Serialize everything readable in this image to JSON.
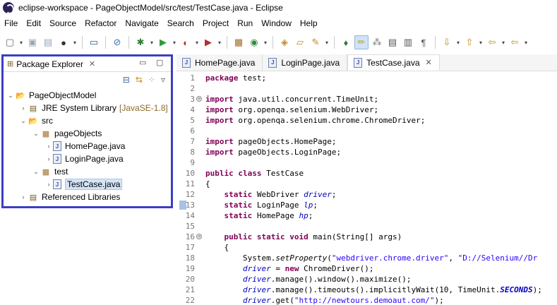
{
  "window": {
    "title": "eclipse-workspace - PageObjectModel/src/test/TestCase.java - Eclipse"
  },
  "menu": [
    "File",
    "Edit",
    "Source",
    "Refactor",
    "Navigate",
    "Search",
    "Project",
    "Run",
    "Window",
    "Help"
  ],
  "toolbar": {
    "icons": [
      "new-icon",
      "save-icon",
      "save-all-icon",
      "profile-icon",
      "terminal-icon",
      "skip-breakpoints-icon",
      "debug-icon",
      "run-icon",
      "run-coverage-icon",
      "external-tools-icon",
      "new-java-package-icon",
      "new-java-class-icon",
      "open-type-icon",
      "open-task-icon",
      "search-icon",
      "annotation-icon",
      "toggle-mark-occurrences-icon",
      "edit-icon",
      "show-whitespace-icon",
      "block-selection-icon",
      "paragraph-icon",
      "next-annotation-icon",
      "previous-annotation-icon",
      "back-icon",
      "forward-icon"
    ]
  },
  "package_explorer": {
    "title": "Package Explorer",
    "tree": [
      {
        "label": "PageObjectModel",
        "icon": "project-icon",
        "depth": 0,
        "expanded": true
      },
      {
        "label": "JRE System Library",
        "decoration": "[JavaSE-1.8]",
        "icon": "library-icon",
        "depth": 1,
        "expanded": false
      },
      {
        "label": "src",
        "icon": "source-folder-icon",
        "depth": 1,
        "expanded": true
      },
      {
        "label": "pageObjects",
        "icon": "package-icon",
        "depth": 2,
        "expanded": true
      },
      {
        "label": "HomePage.java",
        "icon": "java-file-icon",
        "depth": 3,
        "expanded": false
      },
      {
        "label": "LoginPage.java",
        "icon": "java-file-icon",
        "depth": 3,
        "expanded": false
      },
      {
        "label": "test",
        "icon": "package-icon",
        "depth": 2,
        "expanded": true
      },
      {
        "label": "TestCase.java",
        "icon": "java-file-icon",
        "depth": 3,
        "expanded": false,
        "selected": true
      },
      {
        "label": "Referenced Libraries",
        "icon": "library-icon",
        "depth": 1,
        "expanded": false
      }
    ]
  },
  "editor": {
    "tabs": [
      {
        "label": "HomePage.java",
        "active": false
      },
      {
        "label": "LoginPage.java",
        "active": false
      },
      {
        "label": "TestCase.java",
        "active": true
      }
    ],
    "line_numbers": [
      "1",
      "2",
      "3",
      "4",
      "5",
      "6",
      "7",
      "8",
      "9",
      "10",
      "11",
      "12",
      "13",
      "14",
      "15",
      "16",
      "17",
      "18",
      "19",
      "20",
      "21",
      "22"
    ],
    "lines": [
      "package test;",
      "",
      "import java.util.concurrent.TimeUnit;",
      "import org.openqa.selenium.WebDriver;",
      "import org.openqa.selenium.chrome.ChromeDriver;",
      "",
      "import pageObjects.HomePage;",
      "import pageObjects.LoginPage;",
      "",
      "public class TestCase",
      "{",
      "    static WebDriver driver;",
      "    static LoginPage lp;",
      "    static HomePage hp;",
      "",
      "    public static void main(String[] args)",
      "    {",
      "        System.setProperty(\"webdriver.chrome.driver\", \"D://Selenium//Dr",
      "        driver = new ChromeDriver();",
      "        driver.manage().window().maximize();",
      "        driver.manage().timeouts().implicitlyWait(10, TimeUnit.SECONDS);",
      "        driver.get(\"http://newtours.demoaut.com/\");"
    ]
  }
}
